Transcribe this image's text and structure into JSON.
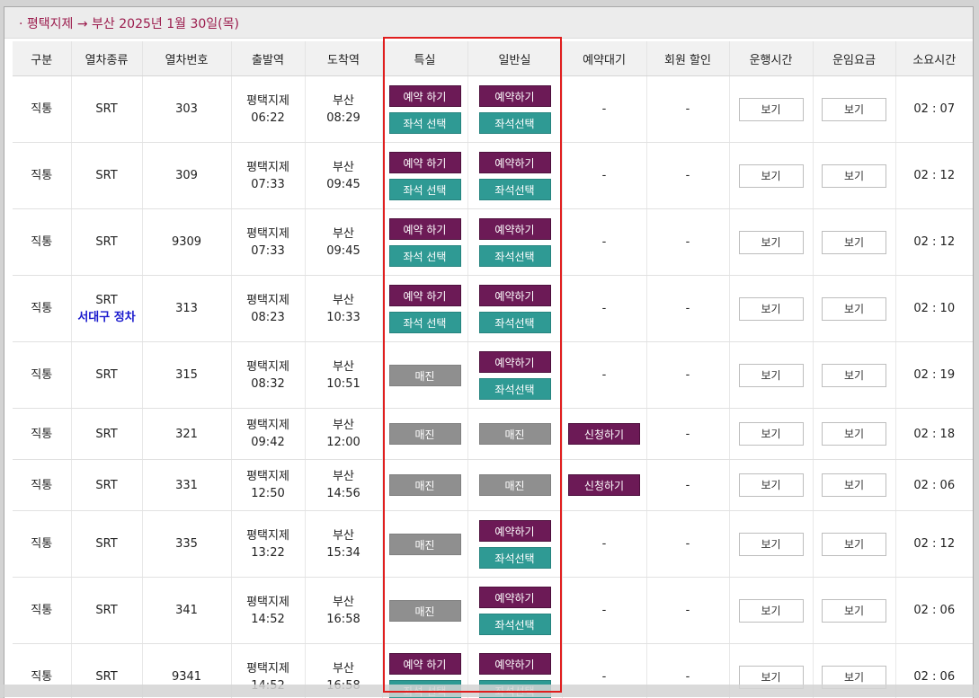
{
  "route": {
    "title": "· 평택지제 → 부산   2025년 1월 30일(목)"
  },
  "colors": {
    "accent": "#9b1c4d",
    "purple": "#6c1a56",
    "teal": "#2f9a94",
    "gray": "#8f8f8f",
    "highlight": "#e01e1e"
  },
  "headers": [
    "구분",
    "열차종류",
    "열차번호",
    "출발역",
    "도착역",
    "특실",
    "일반실",
    "예약대기",
    "회원 할인",
    "운행시간",
    "운임요금",
    "소요시간"
  ],
  "labels": {
    "reserve_special": "예약 하기",
    "reserve_general": "예약하기",
    "seat_special": "좌석 선택",
    "seat_general": "좌석선택",
    "soldout": "매진",
    "apply": "신청하기",
    "view": "보기",
    "dash": "-"
  },
  "rows": [
    {
      "kind": "직통",
      "train": "SRT",
      "note": "",
      "number": "303",
      "dep_station": "평택지제",
      "dep_time": "06:22",
      "arr_station": "부산",
      "arr_time": "08:29",
      "special": "avail",
      "general": "avail",
      "waitlist": "-",
      "discount": "-",
      "duration": "02 : 07"
    },
    {
      "kind": "직통",
      "train": "SRT",
      "note": "",
      "number": "309",
      "dep_station": "평택지제",
      "dep_time": "07:33",
      "arr_station": "부산",
      "arr_time": "09:45",
      "special": "avail",
      "general": "avail",
      "waitlist": "-",
      "discount": "-",
      "duration": "02 : 12"
    },
    {
      "kind": "직통",
      "train": "SRT",
      "note": "",
      "number": "9309",
      "dep_station": "평택지제",
      "dep_time": "07:33",
      "arr_station": "부산",
      "arr_time": "09:45",
      "special": "avail",
      "general": "avail",
      "waitlist": "-",
      "discount": "-",
      "duration": "02 : 12"
    },
    {
      "kind": "직통",
      "train": "SRT",
      "note": "서대구 정차",
      "number": "313",
      "dep_station": "평택지제",
      "dep_time": "08:23",
      "arr_station": "부산",
      "arr_time": "10:33",
      "special": "avail",
      "general": "avail",
      "waitlist": "-",
      "discount": "-",
      "duration": "02 : 10"
    },
    {
      "kind": "직통",
      "train": "SRT",
      "note": "",
      "number": "315",
      "dep_station": "평택지제",
      "dep_time": "08:32",
      "arr_station": "부산",
      "arr_time": "10:51",
      "special": "soldout",
      "general": "avail",
      "waitlist": "-",
      "discount": "-",
      "duration": "02 : 19"
    },
    {
      "kind": "직통",
      "train": "SRT",
      "note": "",
      "number": "321",
      "dep_station": "평택지제",
      "dep_time": "09:42",
      "arr_station": "부산",
      "arr_time": "12:00",
      "special": "soldout",
      "general": "soldout",
      "waitlist": "apply",
      "discount": "-",
      "duration": "02 : 18"
    },
    {
      "kind": "직통",
      "train": "SRT",
      "note": "",
      "number": "331",
      "dep_station": "평택지제",
      "dep_time": "12:50",
      "arr_station": "부산",
      "arr_time": "14:56",
      "special": "soldout",
      "general": "soldout",
      "waitlist": "apply",
      "discount": "-",
      "duration": "02 : 06"
    },
    {
      "kind": "직통",
      "train": "SRT",
      "note": "",
      "number": "335",
      "dep_station": "평택지제",
      "dep_time": "13:22",
      "arr_station": "부산",
      "arr_time": "15:34",
      "special": "soldout",
      "general": "avail",
      "waitlist": "-",
      "discount": "-",
      "duration": "02 : 12"
    },
    {
      "kind": "직통",
      "train": "SRT",
      "note": "",
      "number": "341",
      "dep_station": "평택지제",
      "dep_time": "14:52",
      "arr_station": "부산",
      "arr_time": "16:58",
      "special": "soldout",
      "general": "avail",
      "waitlist": "-",
      "discount": "-",
      "duration": "02 : 06"
    },
    {
      "kind": "직통",
      "train": "SRT",
      "note": "",
      "number": "9341",
      "dep_station": "평택지제",
      "dep_time": "14:52",
      "arr_station": "부산",
      "arr_time": "16:58",
      "special": "avail",
      "general": "avail",
      "waitlist": "-",
      "discount": "-",
      "duration": "02 : 06"
    }
  ]
}
